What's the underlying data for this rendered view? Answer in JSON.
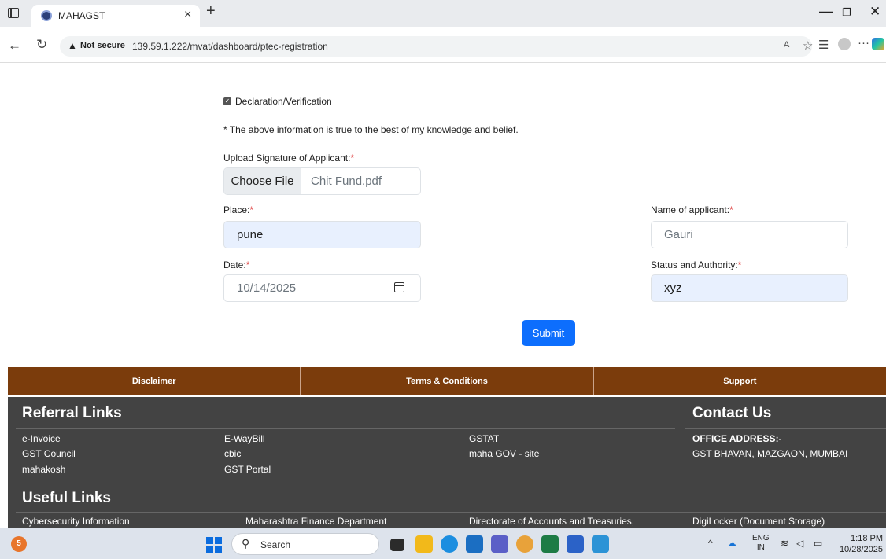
{
  "browser": {
    "tab_title": "MAHAGST",
    "tab_close": "×",
    "new_tab": "+",
    "security_label": "Not secure",
    "url": "139.59.1.222/mvat/dashboard/ptec-registration"
  },
  "form": {
    "declaration_label": "Declaration/Verification",
    "declaration_checked": true,
    "declaration_text": "* The above information is true to the best of my knowledge and belief.",
    "signature_label": "Upload Signature of Applicant:",
    "choose_file_label": "Choose File",
    "file_name": "Chit Fund.pdf",
    "place_label": "Place:",
    "place_value": "pune",
    "name_label": "Name of applicant:",
    "name_placeholder": "Gauri",
    "date_label": "Date:",
    "date_value": "10/14/2025",
    "status_label": "Status and Authority:",
    "status_value": "xyz",
    "required_mark": "*",
    "submit_label": "Submit"
  },
  "footer_bar": [
    "Disclaimer",
    "Terms & Conditions",
    "Support"
  ],
  "footer": {
    "referral_heading": "Referral Links",
    "referral_links": [
      "e-Invoice",
      "E-WayBill",
      "GSTAT",
      "GST Council",
      "cbic",
      "maha GOV - site",
      "mahakosh",
      "GST Portal"
    ],
    "contact_heading": "Contact Us",
    "office_label": "OFFICE ADDRESS:-",
    "office_address": "GST BHAVAN, MAZGAON, MUMBAI",
    "useful_heading": "Useful Links",
    "useful_links": [
      "Cybersecurity Information",
      "Maharashtra Finance Department",
      "Directorate of Accounts and Treasuries,",
      "DigiLocker (Document Storage)"
    ]
  },
  "taskbar": {
    "notification_count": "5",
    "search_label": "Search",
    "lang_line1": "ENG",
    "lang_line2": "IN",
    "time": "1:18 PM",
    "date": "10/28/2025"
  },
  "colors": {
    "brown_bar": "#7b3c0c",
    "footer_bg": "#434343",
    "primary": "#0d6efd",
    "autofill": "#e8f0fe"
  }
}
